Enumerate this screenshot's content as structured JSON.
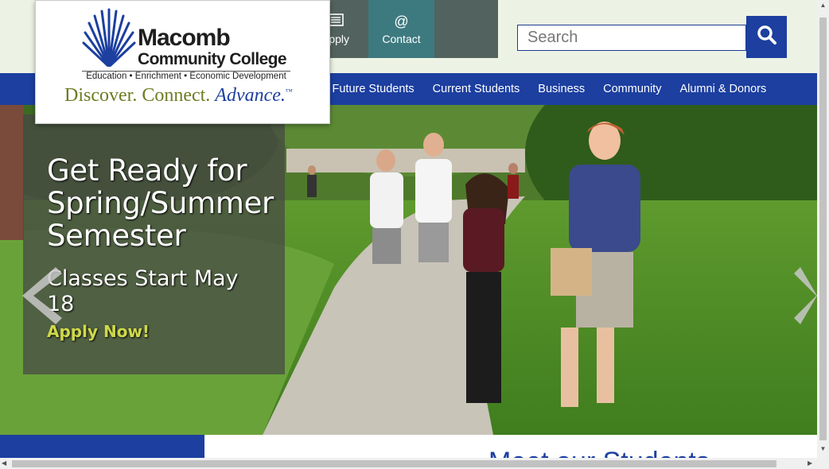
{
  "logo": {
    "name_line1": "Macomb",
    "name_line2": "Community College",
    "tagline": "Education • Enrichment • Economic Development",
    "motto_part1": "Discover. Connect. ",
    "motto_part2": "Advance.",
    "trademark": "™"
  },
  "quicklinks": [
    {
      "label": "Apply",
      "icon": "list-icon"
    },
    {
      "label": "Contact",
      "icon": "at-icon",
      "glyph": "@"
    }
  ],
  "search": {
    "placeholder": "Search",
    "value": "",
    "icon": "search-icon"
  },
  "nav": {
    "items": [
      "Future Students",
      "Current Students",
      "Business",
      "Community",
      "Alumni & Donors"
    ]
  },
  "hero": {
    "title": "Get Ready for Spring/Summer Semester",
    "subtitle": "Classes Start May 18",
    "link": "Apply Now!",
    "prev_icon": "chevron-left-icon",
    "next_icon": "chevron-right-icon"
  },
  "below": {
    "heading": "Meet our Students"
  },
  "colors": {
    "brand_blue": "#1c3fa0",
    "topbar_bg": "#edf3e4",
    "quicklink_bg": "#52625e",
    "contact_bg": "#3d7a80",
    "motto_green": "#6f7b22",
    "link_yellow": "#cfd94a"
  }
}
